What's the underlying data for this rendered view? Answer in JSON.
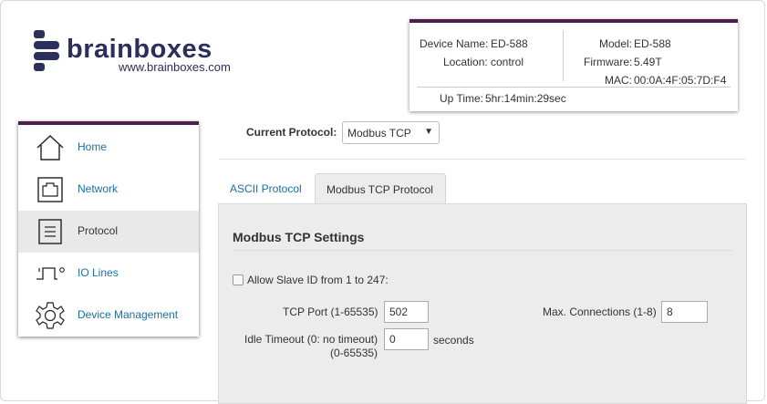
{
  "logo": {
    "word": "brainboxes",
    "url": "www.brainboxes.com"
  },
  "device": {
    "name_label": "Device Name:",
    "name": "ED-588",
    "location_label": "Location:",
    "location": "control",
    "model_label": "Model:",
    "model": "ED-588",
    "firmware_label": "Firmware:",
    "firmware": "5.49T",
    "mac_label": "MAC:",
    "mac": "00:0A:4F:05:7D:F4",
    "uptime_label": "Up Time:",
    "uptime": "5hr:14min:29sec"
  },
  "nav": {
    "items": [
      {
        "label": "Home",
        "icon": "home-icon"
      },
      {
        "label": "Network",
        "icon": "network-port-icon"
      },
      {
        "label": "Protocol",
        "icon": "document-icon"
      },
      {
        "label": "IO Lines",
        "icon": "pulse-icon"
      },
      {
        "label": "Device Management",
        "icon": "gear-icon"
      }
    ],
    "active": "Protocol"
  },
  "protocol": {
    "label": "Current Protocol:",
    "selected": "Modbus TCP"
  },
  "tabs": [
    {
      "label": "ASCII Protocol"
    },
    {
      "label": "Modbus TCP Protocol"
    }
  ],
  "settings": {
    "title": "Modbus TCP Settings",
    "allow_slave_label": "Allow Slave ID from 1 to 247:",
    "tcp_port_label": "TCP Port (1-65535)",
    "tcp_port": "502",
    "max_conn_label": "Max. Connections (1-8)",
    "max_conn": "8",
    "idle_label_1": "Idle Timeout (0: no timeout)",
    "idle_label_2": "(0-65535)",
    "idle_timeout": "0",
    "idle_unit": "seconds"
  },
  "colors": {
    "accent": "#4b1f4d",
    "link": "#1a6ea8",
    "logo": "#2a2f5c"
  }
}
